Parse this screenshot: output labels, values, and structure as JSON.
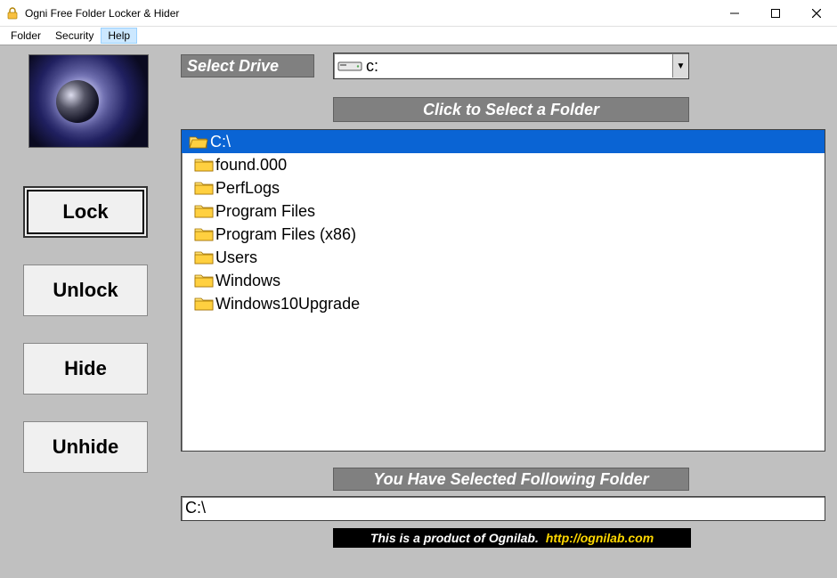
{
  "window": {
    "title": "Ogni Free Folder Locker & Hider"
  },
  "menu": {
    "items": [
      "Folder",
      "Security",
      "Help"
    ],
    "highlighted_index": 2
  },
  "sidebar": {
    "buttons": [
      {
        "label": "Lock",
        "focused": true
      },
      {
        "label": "Unlock",
        "focused": false
      },
      {
        "label": "Hide",
        "focused": false
      },
      {
        "label": "Unhide",
        "focused": false
      }
    ]
  },
  "labels": {
    "select_drive": "Select Drive",
    "select_folder": "Click to Select a Folder",
    "selected_following": "You Have Selected Following Folder"
  },
  "drive": {
    "selected": "c:"
  },
  "tree": {
    "items": [
      {
        "label": "C:\\",
        "selected": true,
        "open": true,
        "indent": 0
      },
      {
        "label": "found.000",
        "selected": false,
        "open": false,
        "indent": 1
      },
      {
        "label": "PerfLogs",
        "selected": false,
        "open": false,
        "indent": 1
      },
      {
        "label": "Program Files",
        "selected": false,
        "open": false,
        "indent": 1
      },
      {
        "label": "Program Files (x86)",
        "selected": false,
        "open": false,
        "indent": 1
      },
      {
        "label": "Users",
        "selected": false,
        "open": false,
        "indent": 1
      },
      {
        "label": "Windows",
        "selected": false,
        "open": false,
        "indent": 1
      },
      {
        "label": "Windows10Upgrade",
        "selected": false,
        "open": false,
        "indent": 1
      }
    ]
  },
  "selected_path": "C:\\",
  "footer": {
    "text": "This  is a product of Ognilab.",
    "link_text": "http://ognilab.com"
  }
}
